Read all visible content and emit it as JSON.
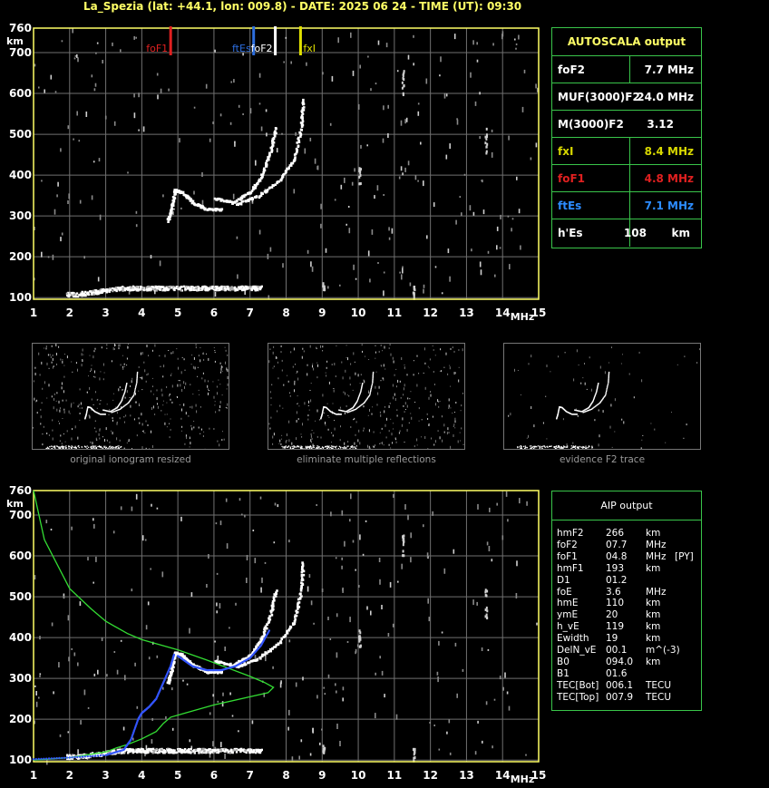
{
  "header": {
    "title": "La_Spezia (lat: +44.1, lon: 009.8) - DATE: 2025 06 24 - TIME (UT): 09:30"
  },
  "colors": {
    "frame": "#ffff66",
    "panel_border": "#39c54a",
    "grid": "#707070",
    "foF1": "#e02020",
    "ftEs": "#2c6ddd",
    "foF2": "#ffffff",
    "fxI": "#e0e000",
    "profile": "#33dd33",
    "fit": "#3355ff"
  },
  "autoscala": {
    "title": "AUTOSCALA output",
    "rows": [
      {
        "label": "foF2",
        "value": "7.7 MHz",
        "color": "#ffffff"
      },
      {
        "label": "MUF(3000)F2",
        "value": "24.0 MHz",
        "color": "#ffffff"
      },
      {
        "label": "M(3000)F2",
        "value": "3.12",
        "color": "#ffffff"
      },
      {
        "label": "fxI",
        "value": "8.4 MHz",
        "color": "#d8d800"
      },
      {
        "label": "foF1",
        "value": "4.8 MHz",
        "color": "#e02020"
      },
      {
        "label": "ftEs",
        "value": "7.1 MHz",
        "color": "#2c8cff"
      },
      {
        "label": "h'Es",
        "value": "108",
        "unit": "km",
        "color": "#ffffff"
      }
    ]
  },
  "aip": {
    "title": "AIP output",
    "rows": [
      {
        "name": "hmF2",
        "value": "266",
        "unit": "km",
        "flag": ""
      },
      {
        "name": "foF2",
        "value": "07.7",
        "unit": "MHz",
        "flag": ""
      },
      {
        "name": "foF1",
        "value": "04.8",
        "unit": "MHz",
        "flag": "[PY]"
      },
      {
        "name": "hmF1",
        "value": "193",
        "unit": "km",
        "flag": ""
      },
      {
        "name": "D1",
        "value": "01.2",
        "unit": "",
        "flag": ""
      },
      {
        "name": "foE",
        "value": "3.6",
        "unit": "MHz",
        "flag": ""
      },
      {
        "name": "hmE",
        "value": "110",
        "unit": "km",
        "flag": ""
      },
      {
        "name": "ymE",
        "value": "20",
        "unit": "km",
        "flag": ""
      },
      {
        "name": "h_vE",
        "value": "119",
        "unit": "km",
        "flag": ""
      },
      {
        "name": "Ewidth",
        "value": "19",
        "unit": "km",
        "flag": ""
      },
      {
        "name": "DelN_vE",
        "value": "00.1",
        "unit": "m^(-3)",
        "flag": ""
      },
      {
        "name": "B0",
        "value": "094.0",
        "unit": "km",
        "flag": ""
      },
      {
        "name": "B1",
        "value": "01.6",
        "unit": "",
        "flag": ""
      },
      {
        "name": "TEC[Bot]",
        "value": "006.1",
        "unit": "TECU",
        "flag": ""
      },
      {
        "name": "TEC[Top]",
        "value": "007.9",
        "unit": "TECU",
        "flag": ""
      }
    ]
  },
  "thumbnails": [
    {
      "caption": "original ionogram resized"
    },
    {
      "caption": "eliminate multiple reflections"
    },
    {
      "caption": "evidence F2 trace"
    }
  ],
  "chart_data": [
    {
      "type": "scatter",
      "title": "",
      "xlabel": "MHz",
      "ylabel": "km",
      "xlim": [
        1,
        15
      ],
      "ylim": [
        96,
        760
      ],
      "x_ticks": [
        1,
        2,
        3,
        4,
        5,
        6,
        7,
        8,
        9,
        10,
        11,
        12,
        13,
        14,
        15
      ],
      "y_ticks": [
        100,
        200,
        300,
        400,
        500,
        600,
        700,
        760
      ],
      "grid": true,
      "markers": [
        {
          "name": "foF1",
          "x": 4.8,
          "color": "#e02020"
        },
        {
          "name": "ftEs",
          "x": 7.1,
          "color": "#2c6ddd"
        },
        {
          "name": "foF2",
          "x": 7.7,
          "color": "#ffffff"
        },
        {
          "name": "fxI",
          "x": 8.4,
          "color": "#e0e000"
        }
      ],
      "traces": [
        {
          "name": "Es trace",
          "x": [
            2.0,
            2.5,
            3.0,
            3.5,
            4.0,
            4.5,
            5.0,
            5.5,
            6.0,
            6.5,
            7.0
          ],
          "y": [
            108,
            110,
            112,
            118,
            122,
            124,
            124,
            122,
            120,
            120,
            118
          ]
        },
        {
          "name": "F1 trace",
          "x": [
            4.7,
            4.8,
            4.9,
            5.1,
            5.4,
            5.8,
            6.2
          ],
          "y": [
            290,
            320,
            365,
            360,
            335,
            318,
            318
          ]
        },
        {
          "name": "F2 o-trace",
          "x": [
            6.0,
            6.5,
            7.0,
            7.3,
            7.55,
            7.7
          ],
          "y": [
            345,
            335,
            360,
            400,
            460,
            520
          ]
        },
        {
          "name": "F2 x-trace",
          "x": [
            6.6,
            7.2,
            7.8,
            8.2,
            8.4,
            8.45
          ],
          "y": [
            330,
            350,
            390,
            440,
            520,
            590
          ]
        }
      ]
    },
    {
      "type": "line",
      "title": "",
      "xlabel": "MHz",
      "ylabel": "km",
      "xlim": [
        1,
        15
      ],
      "ylim": [
        96,
        760
      ],
      "x_ticks": [
        1,
        2,
        3,
        4,
        5,
        6,
        7,
        8,
        9,
        10,
        11,
        12,
        13,
        14,
        15
      ],
      "y_ticks": [
        100,
        200,
        300,
        400,
        500,
        600,
        700,
        760
      ],
      "grid": true,
      "series": [
        {
          "color": "#33dd33",
          "x": [
            1.0,
            1.3,
            2.0,
            2.6,
            3.0,
            3.6,
            4.0,
            4.6,
            5.0,
            5.8,
            6.4,
            7.0,
            7.4,
            7.65,
            7.5,
            7.0,
            6.0,
            5.2,
            4.8,
            4.6,
            4.4,
            4.0,
            3.6,
            3.3,
            3.0,
            2.0,
            1.0
          ],
          "y": [
            760,
            640,
            520,
            470,
            440,
            410,
            395,
            380,
            370,
            345,
            325,
            305,
            290,
            278,
            265,
            255,
            235,
            215,
            205,
            190,
            170,
            152,
            138,
            130,
            120,
            106,
            100
          ]
        },
        {
          "color": "#3355ff",
          "x": [
            1.0,
            2.0,
            3.0,
            3.5,
            3.7,
            3.9,
            4.0,
            4.2,
            4.4,
            4.6,
            4.8,
            4.9
          ],
          "y": [
            102,
            106,
            112,
            125,
            150,
            200,
            215,
            230,
            250,
            290,
            330,
            360
          ]
        },
        {
          "color": "#3355ff",
          "x": [
            5.0,
            5.4,
            5.8,
            6.2,
            6.6,
            7.0,
            7.3,
            7.55
          ],
          "y": [
            355,
            330,
            320,
            320,
            330,
            350,
            380,
            420
          ]
        }
      ]
    }
  ]
}
